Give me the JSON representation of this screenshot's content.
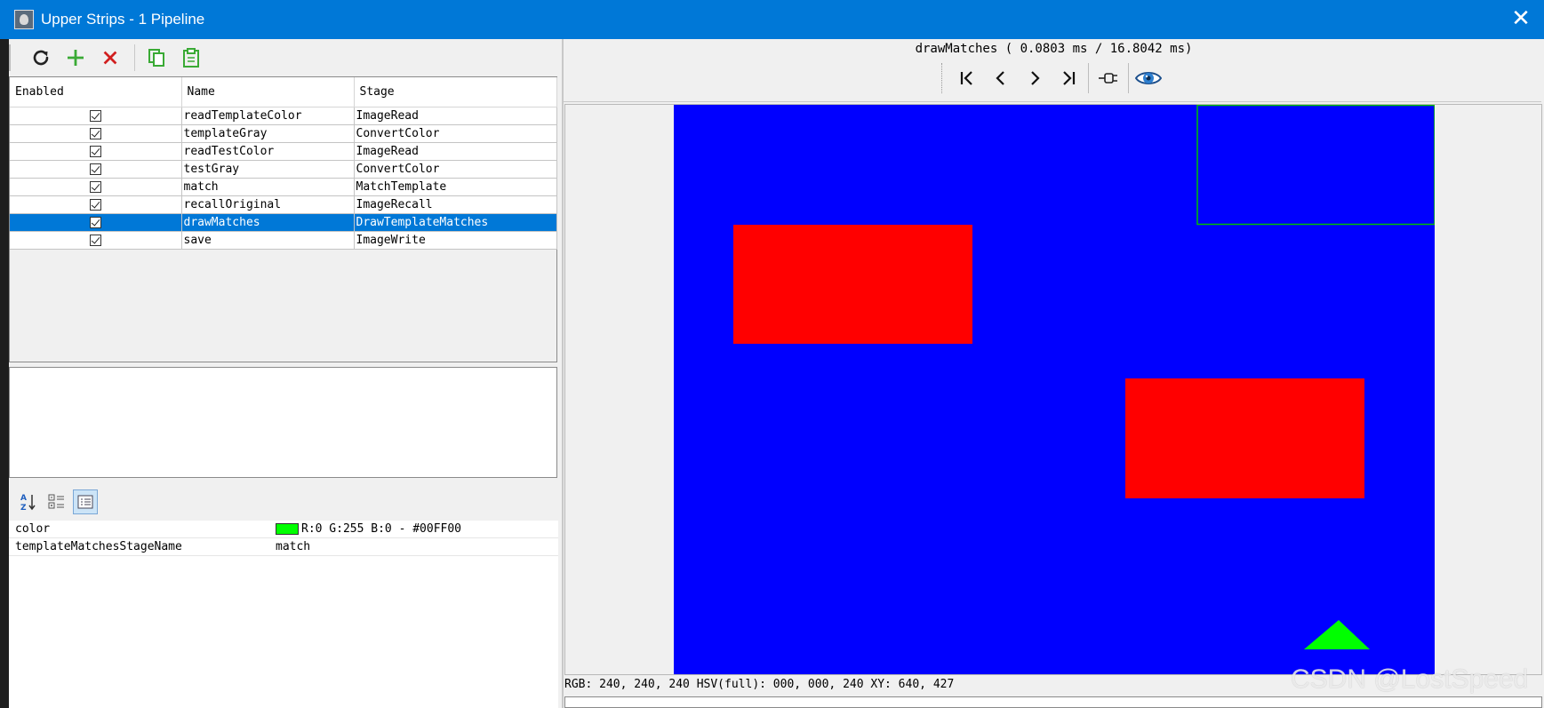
{
  "window": {
    "title": "Upper Strips - 1 Pipeline",
    "close_symbol": "✕"
  },
  "toolbar": {
    "buttons": [
      {
        "name": "refresh-icon",
        "color": "#222222"
      },
      {
        "name": "add-icon",
        "color": "#3aaa35"
      },
      {
        "name": "delete-icon",
        "color": "#d11f1f"
      },
      {
        "name": "copy-icon",
        "color": "#3aaa35"
      },
      {
        "name": "paste-icon",
        "color": "#3aaa35"
      }
    ]
  },
  "pipeline_table": {
    "columns": [
      "Enabled",
      "Name",
      "Stage"
    ],
    "rows": [
      {
        "enabled": true,
        "name": "readTemplateColor",
        "stage": "ImageRead"
      },
      {
        "enabled": true,
        "name": "templateGray",
        "stage": "ConvertColor"
      },
      {
        "enabled": true,
        "name": "readTestColor",
        "stage": "ImageRead"
      },
      {
        "enabled": true,
        "name": "testGray",
        "stage": "ConvertColor"
      },
      {
        "enabled": true,
        "name": "match",
        "stage": "MatchTemplate"
      },
      {
        "enabled": true,
        "name": "recallOriginal",
        "stage": "ImageRecall"
      },
      {
        "enabled": true,
        "name": "drawMatches",
        "stage": "DrawTemplateMatches",
        "selected": true
      },
      {
        "enabled": true,
        "name": "save",
        "stage": "ImageWrite"
      }
    ]
  },
  "properties": {
    "toolbar_icons": [
      "sort-alphabetical-icon",
      "categorized-icon",
      "description-icon"
    ],
    "rows": [
      {
        "name": "color",
        "value": "R:0 G:255 B:0 - #00FF00",
        "swatch": "#00ff00"
      },
      {
        "name": "templateMatchesStageName",
        "value": "match"
      }
    ]
  },
  "viewer": {
    "timing": "drawMatches ( 0.0803 ms / 16.8042 ms)",
    "nav_icons": [
      "first-icon",
      "previous-icon",
      "next-icon",
      "last-icon",
      "pin-icon",
      "eye-icon"
    ],
    "status": "RGB: 240, 240, 240 HSV(full): 000, 000, 240 XY: 640, 427",
    "image_colors": {
      "background": "#0000ff",
      "rectangles": "#ff0000",
      "triangle": "#00ff00",
      "match_outline": "#00c000"
    }
  },
  "watermark": "CSDN @LostSpeed"
}
